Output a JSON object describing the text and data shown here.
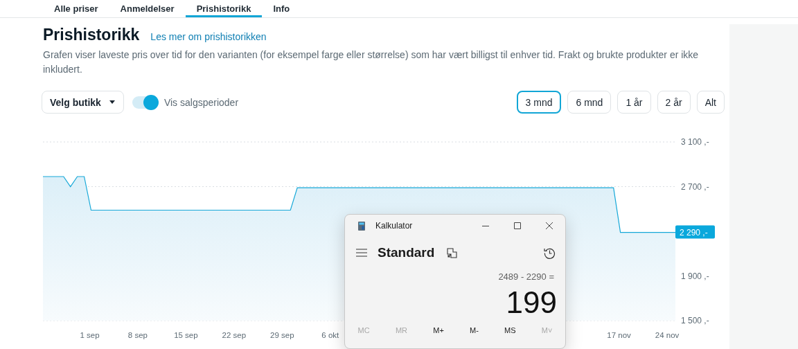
{
  "tabs": [
    {
      "label": "Alle priser",
      "selected": false
    },
    {
      "label": "Anmeldelser",
      "selected": false
    },
    {
      "label": "Prishistorikk",
      "selected": true
    },
    {
      "label": "Info",
      "selected": false
    }
  ],
  "header": {
    "title": "Prishistorikk",
    "link": "Les mer om prishistorikken",
    "description": "Grafen viser laveste pris over tid for den varianten (for eksempel farge eller størrelse) som har vært billigst til enhver tid. Frakt og brukte produkter er ikke inkludert."
  },
  "controls": {
    "store_select": "Velg butikk",
    "toggle": {
      "label": "Vis salgsperioder",
      "on": true
    },
    "ranges": [
      {
        "label": "3 mnd",
        "selected": true
      },
      {
        "label": "6 mnd",
        "selected": false
      },
      {
        "label": "1 år",
        "selected": false
      },
      {
        "label": "2 år",
        "selected": false
      },
      {
        "label": "Alt",
        "selected": false
      }
    ]
  },
  "chart": {
    "chart_data": {
      "type": "area",
      "categories": [
        null,
        null,
        null,
        null,
        null,
        null,
        null,
        "1 sep",
        null,
        null,
        null,
        null,
        null,
        null,
        "8 sep",
        null,
        null,
        null,
        null,
        null,
        null,
        "15 sep",
        null,
        null,
        null,
        null,
        null,
        null,
        "22 sep",
        null,
        null,
        null,
        null,
        null,
        null,
        "29 sep",
        null,
        null,
        null,
        null,
        null,
        null,
        "6 okt",
        null,
        null,
        null,
        null,
        null,
        null,
        null,
        null,
        null,
        null,
        null,
        null,
        null,
        null,
        null,
        null,
        null,
        null,
        null,
        null,
        null,
        null,
        null,
        null,
        null,
        null,
        null,
        null,
        null,
        null,
        null,
        null,
        null,
        null,
        null,
        null,
        null,
        null,
        null,
        null,
        null,
        "17 nov",
        null,
        null,
        null,
        null,
        null,
        null,
        "24 nov",
        null
      ],
      "series": [
        {
          "color": "#16a8d8",
          "values": [
            2790,
            2790,
            2790,
            2790,
            2699,
            2790,
            2790,
            2489,
            2489,
            2489,
            2489,
            2489,
            2489,
            2489,
            2489,
            2489,
            2489,
            2489,
            2489,
            2489,
            2489,
            2489,
            2489,
            2489,
            2489,
            2489,
            2489,
            2489,
            2489,
            2489,
            2489,
            2489,
            2489,
            2489,
            2489,
            2489,
            2489,
            2690,
            2690,
            2690,
            2690,
            2690,
            2690,
            2690,
            2690,
            2690,
            2690,
            2690,
            2690,
            2690,
            2690,
            2690,
            2690,
            2690,
            2690,
            2690,
            2690,
            2690,
            2690,
            2690,
            2690,
            2690,
            2690,
            2690,
            2690,
            2690,
            2690,
            2690,
            2690,
            2690,
            2690,
            2690,
            2690,
            2690,
            2690,
            2690,
            2690,
            2690,
            2690,
            2690,
            2690,
            2690,
            2690,
            2690,
            2290,
            2290,
            2290,
            2290,
            2290,
            2290,
            2290,
            2290,
            2290
          ]
        }
      ],
      "ylim": [
        1500,
        3100
      ],
      "yticks": [
        {
          "value": 1500,
          "label": "1 500 ,-"
        },
        {
          "value": 1900,
          "label": "1 900 ,-"
        },
        {
          "value": 2700,
          "label": "2 700 ,-"
        },
        {
          "value": 3100,
          "label": "3 100 ,-"
        }
      ],
      "annotations": [
        "2 290 ,-"
      ]
    }
  },
  "calculator": {
    "title": "Kalkulator",
    "mode": "Standard",
    "expression": "2489 - 2290 =",
    "result": "199",
    "memory_buttons": [
      {
        "label": "MC",
        "disabled": true
      },
      {
        "label": "MR",
        "disabled": true
      },
      {
        "label": "M+",
        "disabled": false
      },
      {
        "label": "M-",
        "disabled": false
      },
      {
        "label": "MS",
        "disabled": false
      },
      {
        "label": "M˅",
        "disabled": true
      }
    ]
  }
}
